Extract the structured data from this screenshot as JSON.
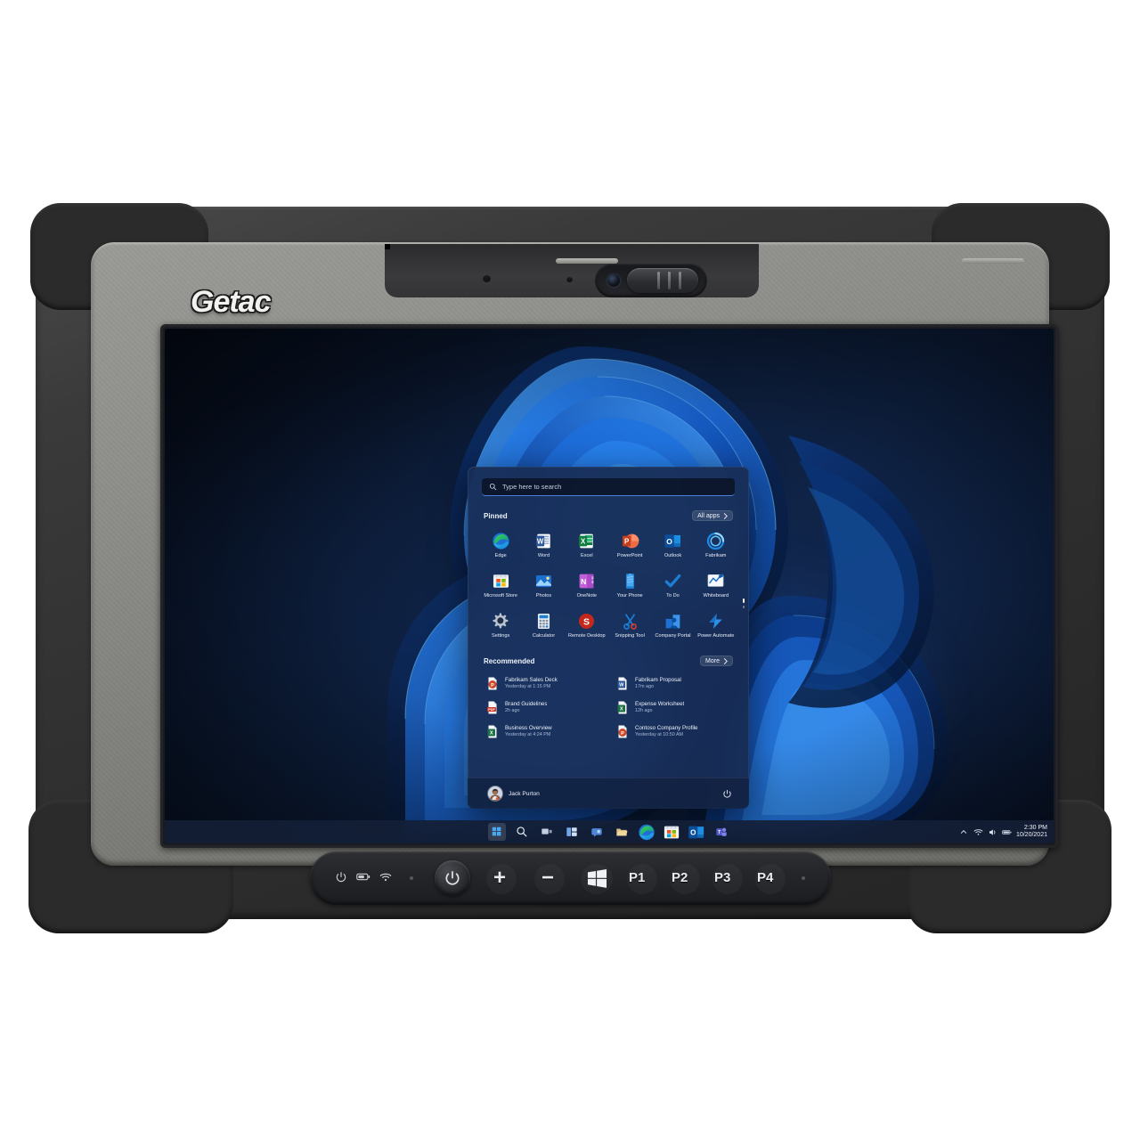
{
  "device": {
    "brand": "Getac",
    "type": "rugged-tablet",
    "camera": {
      "name": "front-camera",
      "shutter": "privacy-shutter"
    },
    "buttons": {
      "indicators": [
        {
          "name": "power-led",
          "glyph": "⏻"
        },
        {
          "name": "battery-led",
          "glyph": "battery"
        },
        {
          "name": "wifi-led",
          "glyph": "wifi"
        }
      ],
      "power_label": "Power",
      "keys": [
        {
          "name": "volume-up-button",
          "label": "+"
        },
        {
          "name": "volume-down-button",
          "label": "−"
        },
        {
          "name": "windows-button",
          "label": "Windows"
        },
        {
          "name": "programmable-button-1",
          "label": "P1"
        },
        {
          "name": "programmable-button-2",
          "label": "P2"
        },
        {
          "name": "programmable-button-3",
          "label": "P3"
        },
        {
          "name": "programmable-button-4",
          "label": "P4"
        }
      ]
    }
  },
  "desktop": {
    "wallpaper": "windows-11-bloom",
    "accent": "#2d6cdf",
    "taskbar": {
      "items": [
        {
          "name": "start-button",
          "label": "Start",
          "active": true
        },
        {
          "name": "search-button",
          "label": "Search"
        },
        {
          "name": "task-view-button",
          "label": "Task View"
        },
        {
          "name": "widgets-button",
          "label": "Widgets"
        },
        {
          "name": "chat-button",
          "label": "Chat"
        },
        {
          "name": "file-explorer-button",
          "label": "File Explorer"
        },
        {
          "name": "edge-button",
          "label": "Microsoft Edge"
        },
        {
          "name": "store-button",
          "label": "Microsoft Store"
        },
        {
          "name": "outlook-button",
          "label": "Outlook"
        },
        {
          "name": "teams-button",
          "label": "Microsoft Teams"
        }
      ],
      "tray": {
        "chevron": "show-hidden-icons",
        "icons": [
          "wifi-icon",
          "volume-icon",
          "battery-icon"
        ],
        "time": "2:30 PM",
        "date": "10/20/2021"
      }
    }
  },
  "start_menu": {
    "search": {
      "placeholder": "Type here to search"
    },
    "pinned": {
      "title": "Pinned",
      "all_apps_label": "All apps",
      "apps": [
        {
          "name": "Edge",
          "icon": "edge-icon"
        },
        {
          "name": "Word",
          "icon": "word-icon"
        },
        {
          "name": "Excel",
          "icon": "excel-icon"
        },
        {
          "name": "PowerPoint",
          "icon": "powerpoint-icon"
        },
        {
          "name": "Outlook",
          "icon": "outlook-icon"
        },
        {
          "name": "Fabrikam",
          "icon": "fabrikam-icon"
        },
        {
          "name": "Microsoft Store",
          "icon": "store-icon"
        },
        {
          "name": "Photos",
          "icon": "photos-icon"
        },
        {
          "name": "OneNote",
          "icon": "onenote-icon"
        },
        {
          "name": "Your Phone",
          "icon": "your-phone-icon"
        },
        {
          "name": "To Do",
          "icon": "todo-icon"
        },
        {
          "name": "Whiteboard",
          "icon": "whiteboard-icon"
        },
        {
          "name": "Settings",
          "icon": "settings-icon"
        },
        {
          "name": "Calculator",
          "icon": "calculator-icon"
        },
        {
          "name": "Remote Desktop",
          "icon": "remote-desktop-icon"
        },
        {
          "name": "Snipping Tool",
          "icon": "snipping-tool-icon"
        },
        {
          "name": "Company Portal",
          "icon": "company-portal-icon"
        },
        {
          "name": "Power Automate",
          "icon": "power-automate-icon"
        }
      ]
    },
    "recommended": {
      "title": "Recommended",
      "more_label": "More",
      "items": [
        {
          "name": "Fabrikam Sales Deck",
          "time": "Yesterday at 1:15 PM",
          "icon": "powerpoint-file-icon"
        },
        {
          "name": "Fabrikam Proposal",
          "time": "17m ago",
          "icon": "word-file-icon"
        },
        {
          "name": "Brand Guidelines",
          "time": "2h ago",
          "icon": "pdf-file-icon"
        },
        {
          "name": "Expense Worksheet",
          "time": "12h ago",
          "icon": "excel-file-icon"
        },
        {
          "name": "Business Overview",
          "time": "Yesterday at 4:24 PM",
          "icon": "excel-file-icon"
        },
        {
          "name": "Contoso Company Profile",
          "time": "Yesterday at 10:50 AM",
          "icon": "powerpoint-file-icon"
        }
      ]
    },
    "footer": {
      "user_name": "Jack Purton",
      "power_label": "Power"
    }
  }
}
